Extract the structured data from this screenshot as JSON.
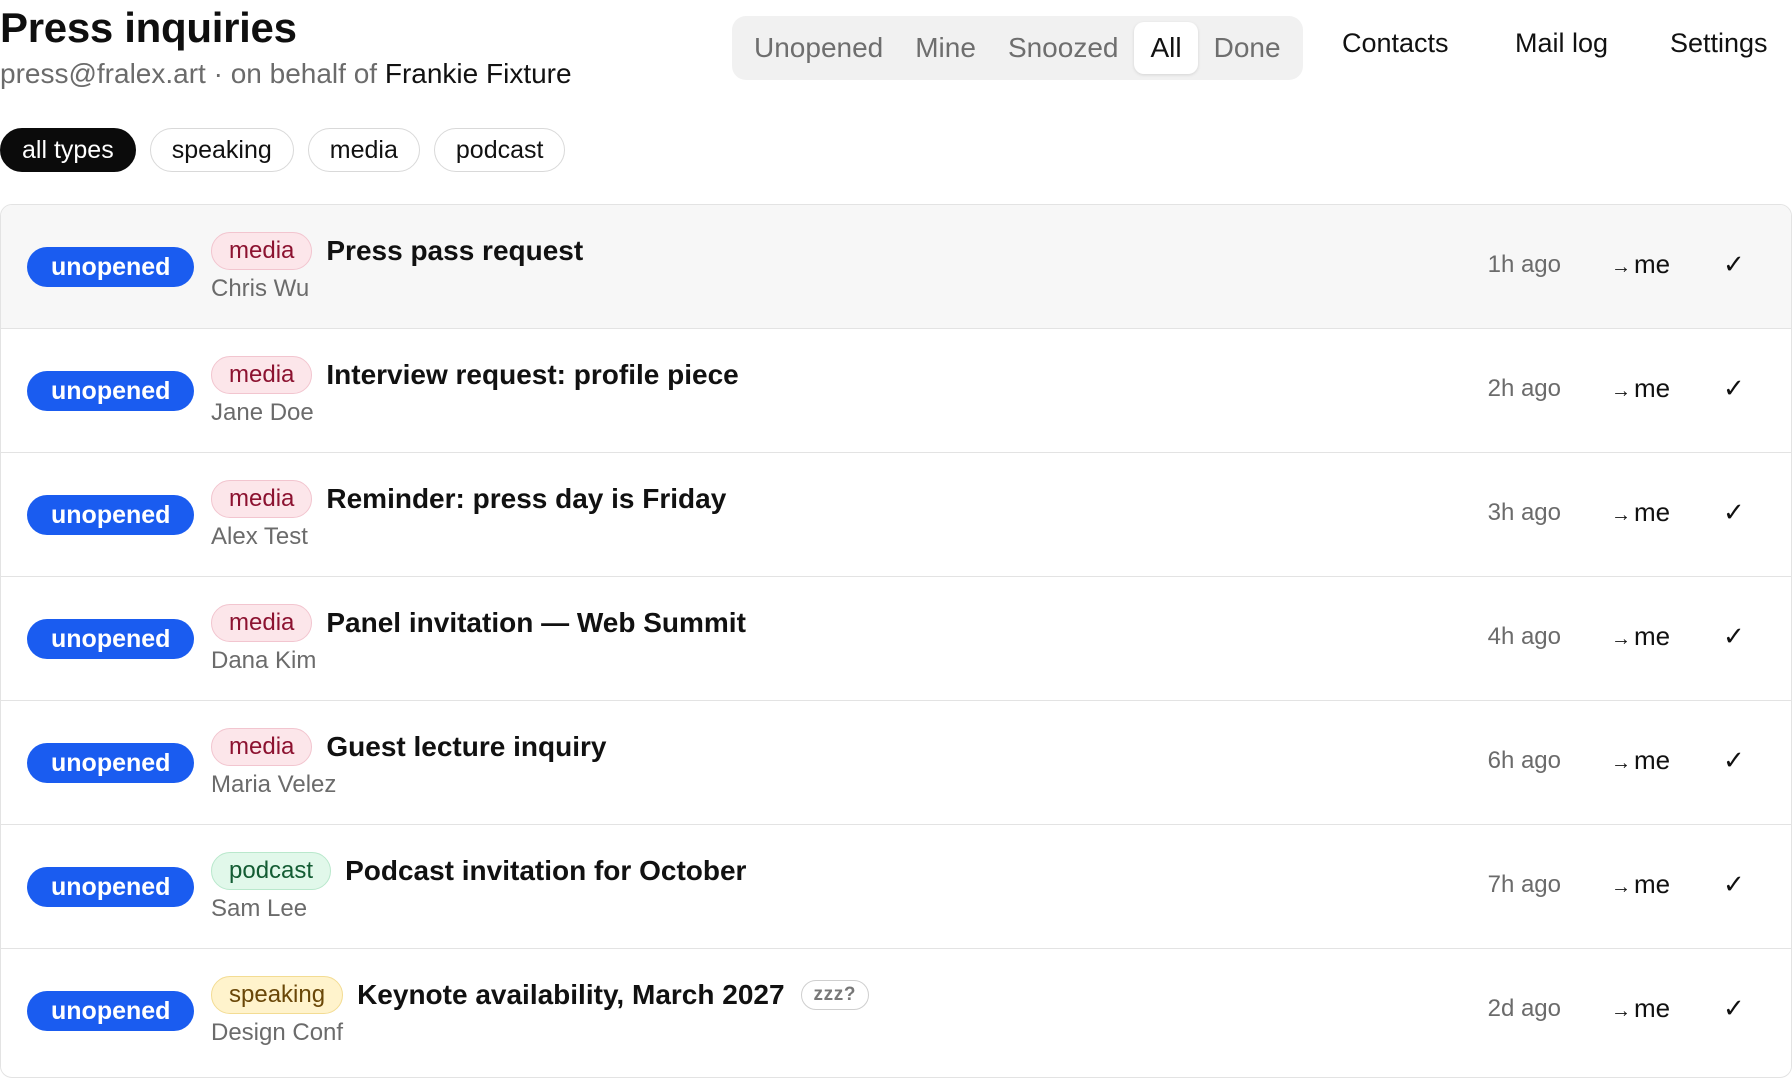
{
  "header": {
    "title": "Press inquiries",
    "email": "press@fralex.art",
    "separator": " · on behalf of ",
    "on_behalf_name": "Frankie Fixture"
  },
  "tabs": [
    {
      "label": "Unopened",
      "active": false
    },
    {
      "label": "Mine",
      "active": false
    },
    {
      "label": "Snoozed",
      "active": false
    },
    {
      "label": "All",
      "active": true
    },
    {
      "label": "Done",
      "active": false
    }
  ],
  "nav": {
    "contacts": "Contacts",
    "mail_log": "Mail log",
    "settings": "Settings"
  },
  "filters": [
    {
      "label": "all types",
      "active": true
    },
    {
      "label": "speaking",
      "active": false
    },
    {
      "label": "media",
      "active": false
    },
    {
      "label": "podcast",
      "active": false
    }
  ],
  "rows": [
    {
      "status": "unopened",
      "tag": "media",
      "subject": "Press pass request",
      "sender": "Chris Wu",
      "time": "1h ago",
      "assign_arrow": "→",
      "assign": "me",
      "check": "✓",
      "hover": true
    },
    {
      "status": "unopened",
      "tag": "media",
      "subject": "Interview request: profile piece",
      "sender": "Jane Doe",
      "time": "2h ago",
      "assign_arrow": "→",
      "assign": "me",
      "check": "✓"
    },
    {
      "status": "unopened",
      "tag": "media",
      "subject": "Reminder: press day is Friday",
      "sender": "Alex Test",
      "time": "3h ago",
      "assign_arrow": "→",
      "assign": "me",
      "check": "✓"
    },
    {
      "status": "unopened",
      "tag": "media",
      "subject": "Panel invitation — Web Summit",
      "sender": "Dana Kim",
      "time": "4h ago",
      "assign_arrow": "→",
      "assign": "me",
      "check": "✓"
    },
    {
      "status": "unopened",
      "tag": "media",
      "subject": "Guest lecture inquiry",
      "sender": "Maria Velez",
      "time": "6h ago",
      "assign_arrow": "→",
      "assign": "me",
      "check": "✓"
    },
    {
      "status": "unopened",
      "tag": "podcast",
      "subject": "Podcast invitation for October",
      "sender": "Sam Lee",
      "time": "7h ago",
      "assign_arrow": "→",
      "assign": "me",
      "check": "✓"
    },
    {
      "status": "unopened",
      "tag": "speaking",
      "subject": "Keynote availability, March 2027",
      "snooze": "zzz?",
      "sender": "Design Conf",
      "time": "2d ago",
      "assign_arrow": "→",
      "assign": "me",
      "check": "✓"
    }
  ],
  "colors": {
    "status_badge": "#1a5cf0",
    "tag_media_bg": "#fce6ea",
    "tag_media_text": "#8c1230",
    "tag_podcast_bg": "#e1f8ea",
    "tag_podcast_text": "#135c33",
    "tag_speaking_bg": "#fff3cc",
    "tag_speaking_text": "#6a4708",
    "active_chip_bg": "#0b0b0b"
  }
}
